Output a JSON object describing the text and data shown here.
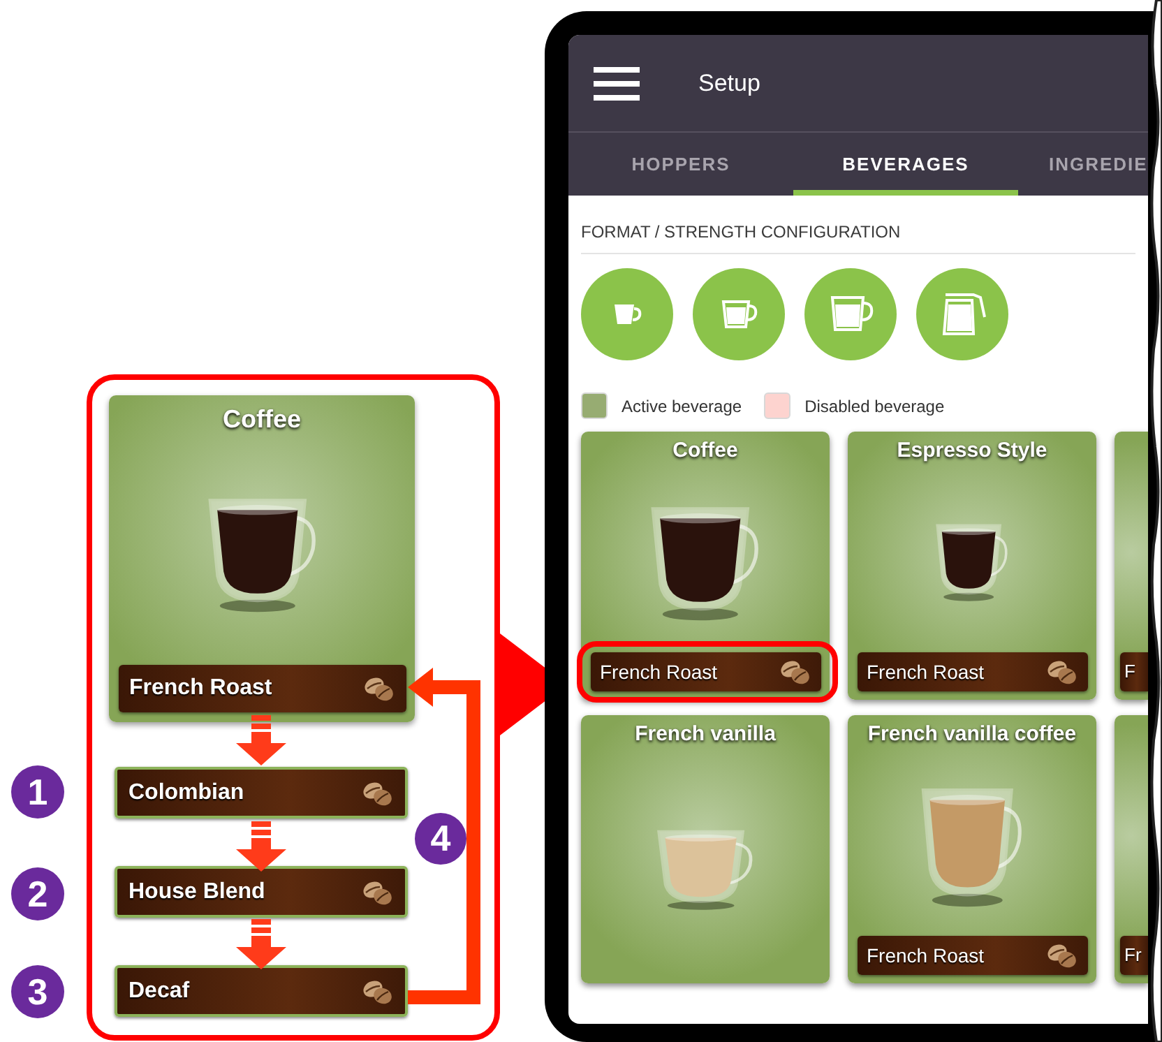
{
  "callout": {
    "card": {
      "name": "Coffee",
      "product": "French Roast"
    },
    "sequence": [
      {
        "step": "1",
        "product": "Colombian"
      },
      {
        "step": "2",
        "product": "House Blend"
      },
      {
        "step": "3",
        "product": "Decaf"
      }
    ],
    "loop_step": "4"
  },
  "tablet": {
    "title": "Setup",
    "tabs": [
      {
        "label": "HOPPERS",
        "selected": false
      },
      {
        "label": "BEVERAGES",
        "selected": true
      },
      {
        "label": "INGREDIE",
        "selected": false
      }
    ],
    "section_title": "FORMAT / STRENGTH CONFIGURATION",
    "formats": [
      {
        "kind": "small-cup"
      },
      {
        "kind": "medium-cup"
      },
      {
        "kind": "large-cup"
      },
      {
        "kind": "carafe"
      }
    ],
    "legend": [
      {
        "label": "Active beverage",
        "color": "#97ac72"
      },
      {
        "label": "Disabled beverage",
        "color": "#fdd3cf"
      }
    ],
    "beverages": [
      {
        "name": "Coffee",
        "product": "French Roast",
        "highlighted": true
      },
      {
        "name": "Espresso Style",
        "product": "French Roast",
        "highlighted": false
      },
      {
        "product": "F",
        "highlighted": false
      },
      {
        "name": "French vanilla",
        "highlighted": false
      },
      {
        "name": "French vanilla coffee",
        "product": "French Roast",
        "highlighted": false
      },
      {
        "product": "Fr",
        "highlighted": false
      }
    ]
  }
}
